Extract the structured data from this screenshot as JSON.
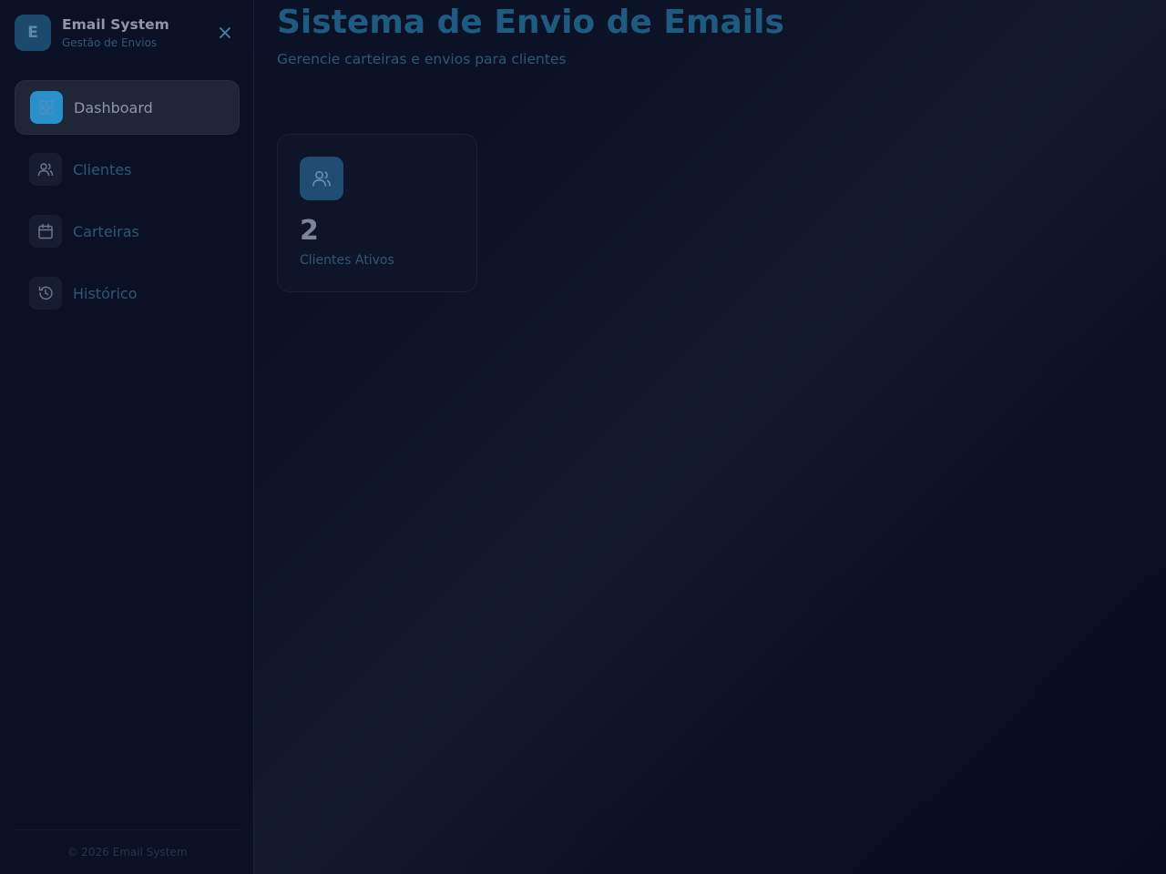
{
  "brand": {
    "logo_letter": "E",
    "title": "Email System",
    "subtitle": "Gestão de Envios"
  },
  "sidebar": {
    "items": [
      {
        "label": "Dashboard",
        "icon": "grid-icon",
        "active": true
      },
      {
        "label": "Clientes",
        "icon": "users-icon",
        "active": false
      },
      {
        "label": "Carteiras",
        "icon": "calendar-icon",
        "active": false
      },
      {
        "label": "Histórico",
        "icon": "history-icon",
        "active": false
      }
    ],
    "footer": "© 2026 Email System"
  },
  "header": {
    "title": "Sistema de Envio de Emails",
    "subtitle": "Gerencie carteiras e envios para clientes"
  },
  "stats": [
    {
      "value": "2",
      "label": "Clientes Ativos",
      "icon": "users-icon"
    }
  ],
  "colors": {
    "accent": "#2a90cc",
    "title": "#1f5a80",
    "background": "#0b1124"
  }
}
